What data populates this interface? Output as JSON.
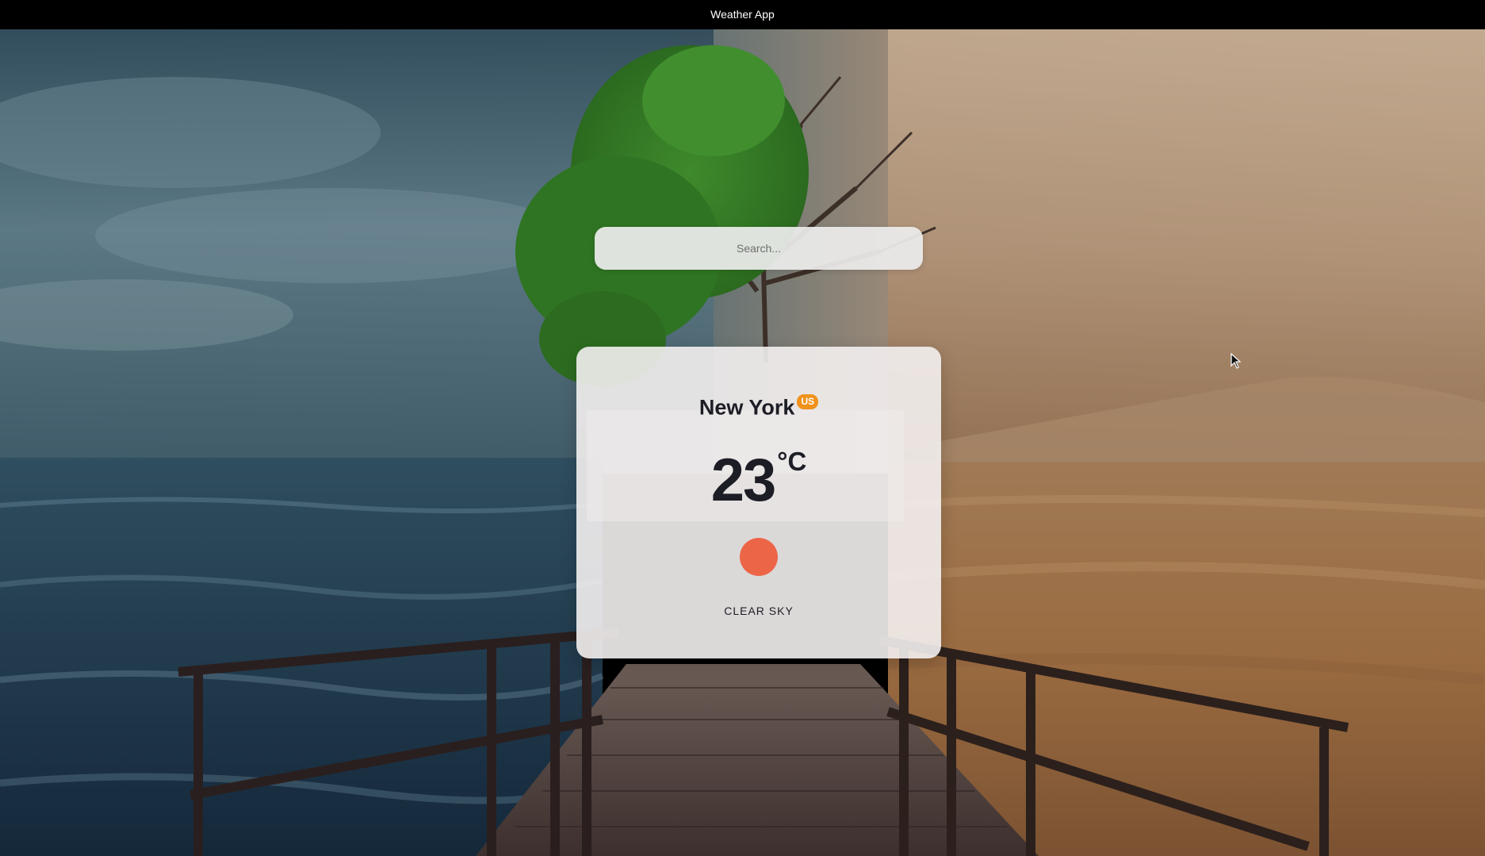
{
  "window": {
    "title": "Weather App"
  },
  "search": {
    "placeholder": "Search..."
  },
  "weather": {
    "city": "New York",
    "country": "US",
    "temperature": "23",
    "unit": "°C",
    "description": "CLEAR SKY",
    "icon": "sun-icon",
    "icon_color": "#ec6547"
  },
  "colors": {
    "country_badge": "#f0921c",
    "card_background": "#f3f0f0",
    "text": "#1d1d25"
  }
}
